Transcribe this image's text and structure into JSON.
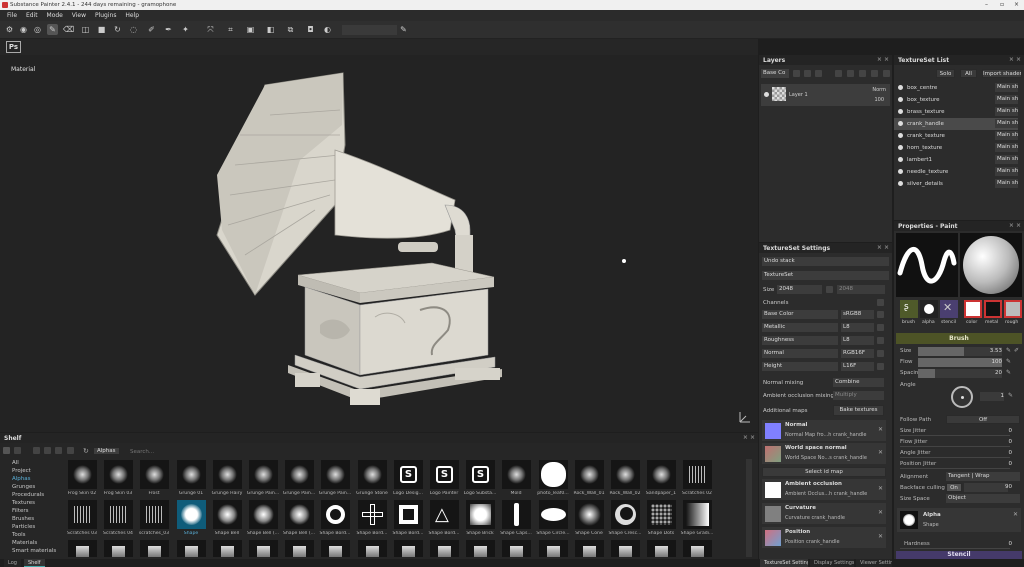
{
  "window": {
    "title": "Substance Painter 2.4.1 - 244 days remaining - gramophone"
  },
  "menu": [
    "File",
    "Edit",
    "Mode",
    "View",
    "Plugins",
    "Help"
  ],
  "ps_button": "Ps",
  "viewport": {
    "label": "Material"
  },
  "layers": {
    "title": "Layers",
    "blend_mode": "Base Co",
    "layer_name": "Layer 1",
    "layer_blend": "Norm",
    "layer_opacity": "100"
  },
  "textureset_list": {
    "title": "TextureSet List",
    "solo": "Solo",
    "all": "All",
    "import": "Import shaders",
    "items": [
      {
        "name": "box_centre",
        "shader": "Main shader"
      },
      {
        "name": "box_texture",
        "shader": "Main shader"
      },
      {
        "name": "brass_texture",
        "shader": "Main shader"
      },
      {
        "name": "crank_handle",
        "shader": "Main shader"
      },
      {
        "name": "crank_texture",
        "shader": "Main shader"
      },
      {
        "name": "horn_texture",
        "shader": "Main shader"
      },
      {
        "name": "lambert1",
        "shader": "Main shader"
      },
      {
        "name": "needle_texture",
        "shader": "Main shader"
      },
      {
        "name": "silver_details",
        "shader": "Main shader"
      }
    ]
  },
  "textureset_settings": {
    "title": "TextureSet Settings",
    "undo_stack": "Undo stack",
    "textureset": "TextureSet",
    "size_label": "Size",
    "size_value": "2048",
    "size_value2": "2048",
    "channels_label": "Channels",
    "channels": [
      {
        "name": "Base Color",
        "format": "sRGB8"
      },
      {
        "name": "Metallic",
        "format": "L8"
      },
      {
        "name": "Roughness",
        "format": "L8"
      },
      {
        "name": "Normal",
        "format": "RGB16F"
      },
      {
        "name": "Height",
        "format": "L16F"
      }
    ],
    "normal_mixing_label": "Normal mixing",
    "normal_mixing_value": "Combine",
    "ao_mixing_label": "Ambient occlusion mixing",
    "ao_mixing_value": "Multiply",
    "additional_maps": "Additional maps",
    "bake_textures": "Bake textures",
    "maps": [
      {
        "title": "Normal",
        "sub": "Normal Map fro...h crank_handle",
        "color": "#8080ff"
      },
      {
        "title": "World space normal",
        "sub": "World Space No...s crank_handle",
        "color": "#c07070"
      },
      {
        "title": "Ambient occlusion",
        "sub": "Ambient Occlus...h crank_handle",
        "color": "#ffffff"
      },
      {
        "title": "Curvature",
        "sub": "Curvature crank_handle",
        "color": "#808080"
      },
      {
        "title": "Position",
        "sub": "Position crank_handle",
        "color": "#d07080"
      }
    ],
    "select_id_map": "Select id map"
  },
  "properties": {
    "title": "Properties - Paint",
    "chips": [
      "brush",
      "alpha",
      "stencil"
    ],
    "mat_chips": [
      "color",
      "metal",
      "rough"
    ],
    "brush_header": "Brush",
    "size_label": "Size",
    "size_value": "3.53",
    "size_fill": 0.55,
    "flow_label": "Flow",
    "flow_value": "100",
    "flow_fill": 1.0,
    "spacing_label": "Spacing",
    "spacing_value": "20",
    "spacing_fill": 0.2,
    "angle_label": "Angle",
    "angle_value": "1",
    "follow_path_label": "Follow Path",
    "follow_path_value": "Off",
    "size_jitter": "Size Jitter",
    "flow_jitter": "Flow Jitter",
    "angle_jitter": "Angle Jitter",
    "position_jitter": "Position Jitter",
    "jitter_value": "0",
    "alignment_label": "Alignment",
    "alignment_value": "Tangent | Wrap",
    "backface_label": "Backface culling",
    "backface_toggle": "On",
    "backface_value": "90",
    "size_space_label": "Size Space",
    "size_space_value": "Object",
    "alpha_title": "Alpha",
    "alpha_sub": "Shape",
    "hardness_label": "Hardness",
    "hardness_value": "0",
    "stencil_header": "Stencil"
  },
  "shelf": {
    "title": "Shelf",
    "filter_tag": "Alphas",
    "search_placeholder": "Search...",
    "nav": [
      "All",
      "Project",
      "Alphas",
      "Grunges",
      "Procedurals",
      "Textures",
      "Filters",
      "Brushes",
      "Particles",
      "Tools",
      "Materials",
      "Smart materials"
    ],
    "active_nav": "Alphas",
    "row1": [
      "Frog Skin 02",
      "Frog Skin 03",
      "Frost",
      "Grunge 01",
      "Grunge Hairy",
      "Grunge Pain...",
      "Grunge Pain...",
      "Grunge Pain...",
      "Grunge Stone",
      "Logo Desig...",
      "Logo Painter",
      "Logo Substa...",
      "Mold",
      "photo_leaf0...",
      "Rock_Wall_01",
      "Rock_Wall_02",
      "Sandpaper_1",
      "Scratches 02"
    ],
    "row2": [
      "Scratches 03",
      "Scratches 04",
      "scratches_03",
      "Shape",
      "Shape Bell",
      "Shape Bell (...",
      "Shape Bell (...",
      "Shape Bord...",
      "Shape Bord...",
      "Shape Bord...",
      "Shape Bord...",
      "Shape Brick",
      "Shape Caps...",
      "Shape Circle...",
      "Shape Cone",
      "Shape Cresc...",
      "Shape Dots",
      "Shape Gradi..."
    ]
  },
  "bottom_tabs": {
    "log": "Log",
    "shelf": "Shelf",
    "tss": "TextureSet Settings",
    "display": "Display Settings",
    "viewer": "Viewer Settings"
  }
}
